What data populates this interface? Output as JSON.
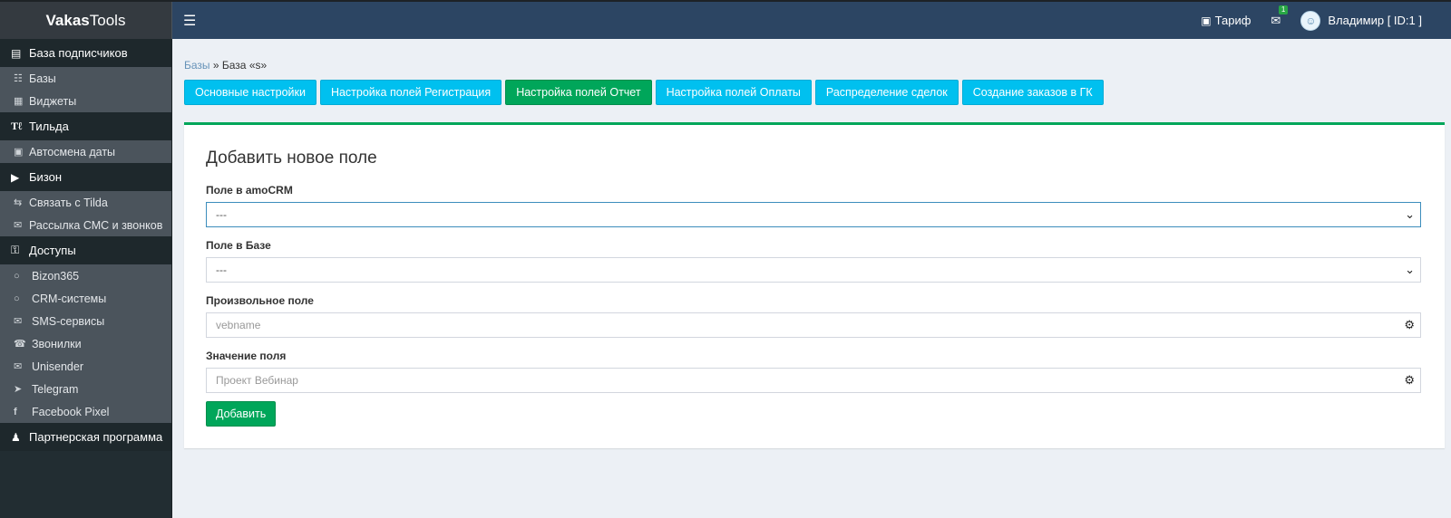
{
  "header": {
    "brand_bold": "Vakas",
    "brand_light": "Tools",
    "tariff": "Тариф",
    "mail_badge": "1",
    "user": "Владимир [ ID:1 ]"
  },
  "sidebar": {
    "sections": [
      {
        "label": "База подписчиков",
        "icon": "database-icon"
      },
      {
        "label": "Тильда",
        "icon": "tilda-icon"
      },
      {
        "label": "Бизон",
        "icon": "youtube-icon"
      },
      {
        "label": "Доступы",
        "icon": "key-icon"
      },
      {
        "label": "Партнерская программа",
        "icon": "users-icon"
      }
    ],
    "items": {
      "bases": "Базы",
      "widgets": "Виджеты",
      "autodate": "Автосмена даты",
      "link_tilda": "Связать с Tilda",
      "sms_calls": "Рассылка СМС и звонков",
      "bizon365": "Bizon365",
      "crm": "CRM-системы",
      "sms_services": "SMS-сервисы",
      "callers": "Звонилки",
      "unisender": "Unisender",
      "telegram": "Telegram",
      "facebook": "Facebook Pixel"
    }
  },
  "breadcrumb": {
    "link": "Базы",
    "sep": " » ",
    "current": "База «s»"
  },
  "tabs": [
    {
      "label": "Основные настройки"
    },
    {
      "label": "Настройка полей Регистрация"
    },
    {
      "label": "Настройка полей Отчет"
    },
    {
      "label": "Настройка полей Оплаты"
    },
    {
      "label": "Распределение сделок"
    },
    {
      "label": "Создание заказов в ГК"
    }
  ],
  "form": {
    "title": "Добавить новое поле",
    "amocrm_label": "Поле в amoCRM",
    "amocrm_value": "---",
    "base_label": "Поле в Базе",
    "base_value": "---",
    "custom_label": "Произвольное поле",
    "custom_placeholder": "vebname",
    "value_label": "Значение поля",
    "value_placeholder": "Проект Вебинар",
    "submit": "Добавить"
  },
  "colors": {
    "navbar": "#2c4563",
    "sidebar": "#222d32",
    "tab": "#00c0ef",
    "active": "#00a65a"
  }
}
